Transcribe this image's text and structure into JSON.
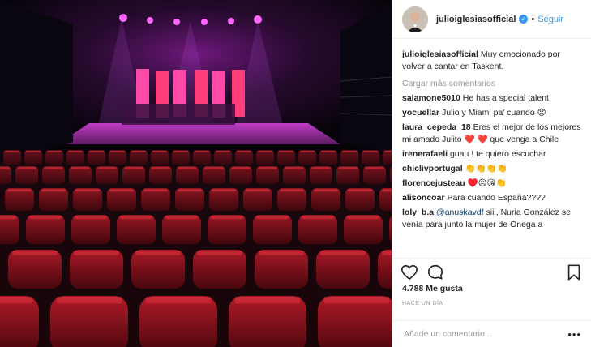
{
  "post": {
    "username": "julioiglesiasofficial",
    "follow_label": "Seguir",
    "separator": "•",
    "verified_symbol": "✓"
  },
  "caption": {
    "username": "julioiglesiasofficial",
    "text": "Muy emocionado por volver a cantar en Taskent."
  },
  "load_more_label": "Cargar más comentarios",
  "comments": [
    {
      "username": "salamone5010",
      "text": "He has a special talent"
    },
    {
      "username": "yocuellar",
      "text": "Julio y Miami pa' cuando 😞"
    },
    {
      "username": "laura_cepeda_18",
      "text": "Eres el mejor de los mejores mi amado Julito ❤️ ❤️ que venga a Chile"
    },
    {
      "username": "irenerafaeli",
      "text": "guau ! te quiero escuchar"
    },
    {
      "username": "chiclivportugal",
      "text": "👏👏👏👏"
    },
    {
      "username": "florencejusteau",
      "text": "♥️😥😘👏"
    },
    {
      "username": "alisoncoar",
      "text": "Para cuando España????"
    },
    {
      "username": "loly_b.a",
      "mention": "@anuskavdf",
      "text": "siii, Nuria González se venía para junto la mujer de Onega a"
    }
  ],
  "stats": {
    "likes": "4.788 Me gusta",
    "time": "HACE UN DÍA"
  },
  "add_comment": {
    "placeholder": "Añade un comentario...",
    "more_label": "•••"
  },
  "icons": {
    "like": "heart-icon",
    "comment": "comment-icon",
    "save": "bookmark-icon"
  },
  "colors": {
    "link": "#3897f0",
    "muted": "#999999",
    "text": "#262626"
  }
}
